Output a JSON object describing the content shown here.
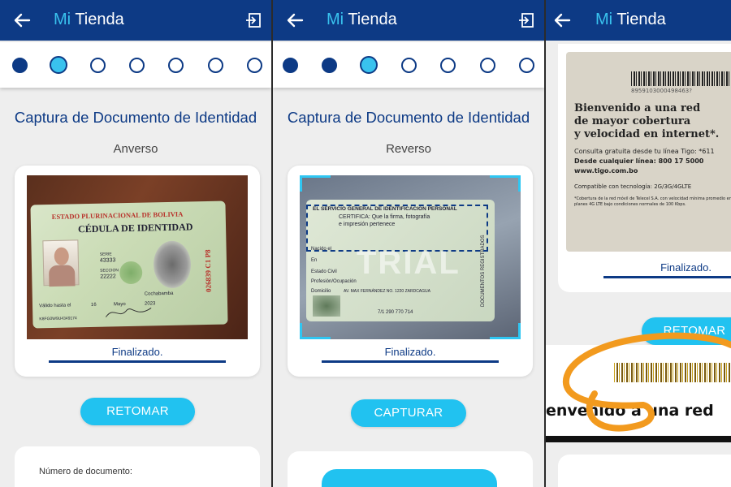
{
  "app": {
    "title_prefix": "Mi",
    "title_suffix": "Tienda"
  },
  "screen1": {
    "heading": "Captura de Documento de Identidad",
    "side_label": "Anverso",
    "status": "Finalizado.",
    "button": "RETOMAR",
    "field_label": "Número de documento:",
    "card_texts": {
      "state": "ESTADO PLURINACIONAL DE BOLIVIA",
      "title": "CÉDULA DE IDENTIDAD",
      "serie_label": "SERIE",
      "serie": "43333",
      "seccion_label": "SECCION",
      "seccion": "22222",
      "place": "Cochabamba",
      "valid_label": "Válido hasta el",
      "valid_day": "16",
      "valid_month": "Mayo",
      "valid_year": "2023",
      "number": "026839 C1 P8",
      "code": "K8FG0W9U4349174"
    }
  },
  "screen2": {
    "heading": "Captura de Documento de Identidad",
    "side_label": "Reverso",
    "status": "Finalizado.",
    "button": "CAPTURAR",
    "watermark": "TRIAL",
    "card_texts": {
      "line1": "EL SERVICIO GENERAL DE IDENTIFICACIÓN PERSONAL",
      "line2": "CERTIFICA: Que la firma, fotografía",
      "line3": "e impresión pertenece",
      "nacido": "Nacido el",
      "en": "En",
      "estado_civil": "Estado Civil",
      "profesion": "Profesión/Ocupación",
      "domicilio": "Domicilio",
      "domicilio_val": "AV. MAX FERNÁNDEZ NO. 1220 ZARDCAGUA",
      "side": "DOCUMENTOS REGISTRADOS",
      "num": "7/1 290 770 714"
    }
  },
  "screen3": {
    "status": "Finalizado.",
    "button": "RETOMAR",
    "sim": {
      "barcode_num": "8959103000498463?",
      "welcome_1": "Bienvenido a una red",
      "welcome_2": "de mayor cobertura",
      "welcome_3": "y velocidad en internet*.",
      "consulta": "Consulta gratuita desde tu línea Tigo: *611",
      "desde": "Desde cualquier línea: 800 17 5000",
      "web": "www.tigo.com.bo",
      "compat": "Compatible con tecnología: 2G/3G/4GLTE",
      "fine": "*Cobertura de la red móvil de Telecel S.A. con velocidad mínima promedio en planes 4G LTE bajo condiciones normales de 100 Kbps."
    },
    "zoom_text": "envenido a una red"
  }
}
